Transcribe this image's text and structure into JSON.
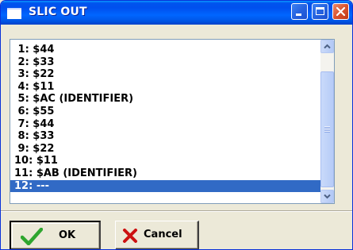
{
  "window": {
    "title": "SLIC OUT"
  },
  "list": {
    "items": [
      {
        "label": " 1: $44"
      },
      {
        "label": " 2: $33"
      },
      {
        "label": " 3: $22"
      },
      {
        "label": " 4: $11"
      },
      {
        "label": " 5: $AC (IDENTIFIER)"
      },
      {
        "label": " 6: $55"
      },
      {
        "label": " 7: $44"
      },
      {
        "label": " 8: $33"
      },
      {
        "label": " 9: $22"
      },
      {
        "label": "10: $11"
      },
      {
        "label": "11: $AB (IDENTIFIER)"
      },
      {
        "label": "12: ---"
      }
    ],
    "selected_index": 11
  },
  "buttons": {
    "ok_label": "OK",
    "cancel_label": "Cancel"
  },
  "icons": {
    "window_icon": "window-icon",
    "minimize": "minimize-icon",
    "maximize": "maximize-icon",
    "close": "close-icon",
    "ok": "checkmark-icon",
    "cancel": "x-icon"
  },
  "colors": {
    "titlebar": "#0054e3",
    "selection": "#316ac5",
    "close_button": "#d9532e",
    "ok_check": "#2fa62f",
    "cancel_x": "#cc1111"
  }
}
